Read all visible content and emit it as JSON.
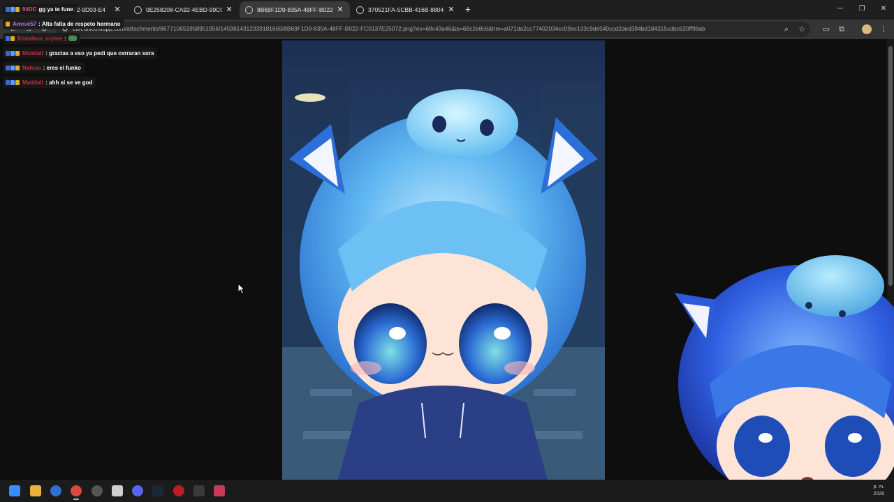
{
  "browser": {
    "tabs": [
      {
        "title": "94DC",
        "title_suffix": "22-9D03-E4",
        "active": false
      },
      {
        "title": "0E258208-CA92-4EBD-99CC-A",
        "active": false
      },
      {
        "title": "8B69F1D9-835A-48FF-B022-FC",
        "active": true
      },
      {
        "title": "370521FA-5CBB-416B-8804-9E",
        "active": false
      }
    ],
    "url_host": "cdn.discordapp.com",
    "url_path": "/attachments/867710651958951956/1459814312339181669/8B69F1D9-835A-48FF-B022-FC0137E25072.png?ex=69c43a46&is=69c2e8c6&hm=a071da2cc77402034cc09ec133c9de540ccd2ded384bd184315cdbc620ff98ab"
  },
  "chat": {
    "messages": [
      {
        "user": "",
        "text": "gg ya te fune",
        "user_color": "#e05070"
      },
      {
        "user": "Aweve57",
        "text": "Alta falta de respeto hermano",
        "user_color": "#b070e0"
      },
      {
        "user": "Kintaikan_crytes",
        "text": "",
        "user_color": "#c0303a"
      },
      {
        "user": "Matidalt",
        "text": "gracias a eso ya pedi que cerraran sora",
        "user_color": "#c0303a"
      },
      {
        "user": "Nahina",
        "text": "eres el funko",
        "user_color": "#c0303a"
      },
      {
        "user": "Matidalt",
        "text": "ahh si se ve god",
        "user_color": "#c0303a"
      }
    ]
  },
  "tray": {
    "time": "p. m.",
    "year": "2026"
  },
  "icons": {
    "start": "windows-start-icon",
    "explorer": "file-explorer-icon",
    "chrome": "chrome-icon",
    "discord": "discord-icon",
    "steam": "steam-icon",
    "opera": "opera-gx-icon"
  }
}
